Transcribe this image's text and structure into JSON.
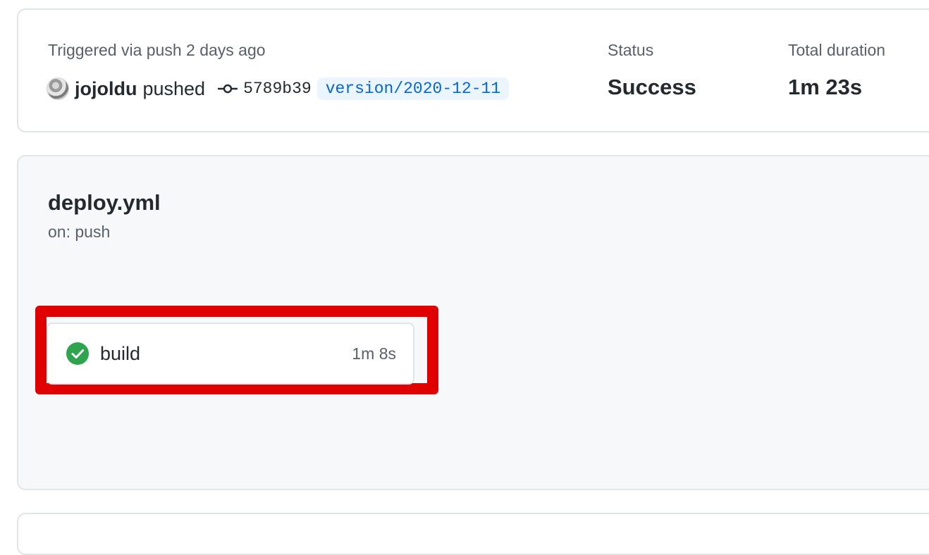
{
  "summary": {
    "trigger_text": "Triggered via push 2 days ago",
    "actor": "jojoldu",
    "action": "pushed",
    "commit_sha": "5789b39",
    "branch": "version/2020-12-11",
    "status_label": "Status",
    "status_value": "Success",
    "duration_label": "Total duration",
    "duration_value": "1m 23s"
  },
  "workflow": {
    "name": "deploy.yml",
    "trigger": "on: push",
    "jobs": [
      {
        "name": "build",
        "duration": "1m 8s",
        "status": "success",
        "icon": "check-circle-icon"
      }
    ]
  },
  "colors": {
    "success": "#2ea44f",
    "link": "#0366d6",
    "highlight": "#e00000"
  }
}
